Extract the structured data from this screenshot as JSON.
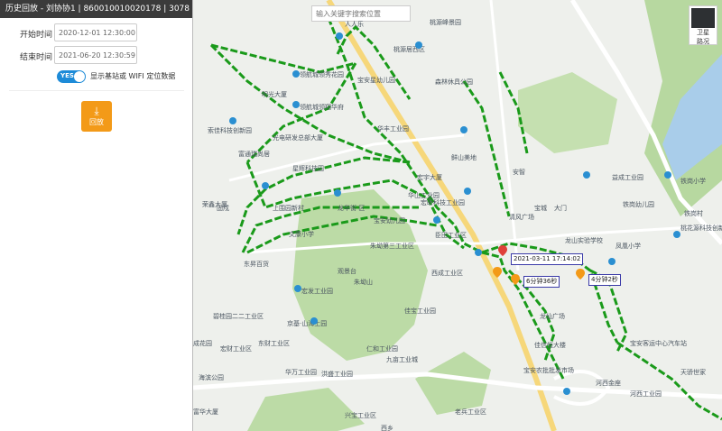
{
  "panel": {
    "title": "历史回放 - 刘协协1 | 860010010020178 | 3078",
    "start_label": "开始时间",
    "start_value": "2020-12-01 12:30:00",
    "end_label": "结束时间",
    "end_value": "2021-06-20 12:30:59",
    "toggle_text": "YES",
    "toggle_on": true,
    "toggle_label": "显示基站或 WIFI 定位数据",
    "replay_label": "回放"
  },
  "map": {
    "search_placeholder": "输入关键字搜索位置",
    "layer_satellite": "卫星",
    "layer_road": "路况",
    "route_color": "#1a9a1a",
    "labels": [
      "人人乐",
      "桃源峰景园",
      "桃源居西区",
      "宝安星幼儿园",
      "森林休具公园",
      "领航城领秀花园",
      "领航城领翔华府",
      "明光大厦",
      "索佳科技创新园",
      "光电研发总部大厦",
      "富通瑞尚居",
      "星辉科技园",
      "华丰工业园",
      "鲜山美地",
      "宏宇大厦",
      "宏昕科技工业园",
      "上围园新村",
      "文康小学",
      "龙华街 区",
      "宝安幼儿园",
      "朱坳第三工业区",
      "观景台",
      "荣鑫大厦",
      "固戍",
      "东昇百货",
      "臣田工业区",
      "龙山实验学校",
      "凤凰小学",
      "铁岗幼儿园",
      "铁岗小学",
      "益成工业园",
      "宏发工业园",
      "京基·山海上园",
      "佳宝工业园",
      "碧桂园二二工业区",
      "成花园",
      "东财工业区",
      "华万工业园",
      "洪盛工业园",
      "宏财工业区",
      "海滨公园",
      "富华大厦",
      "佳信恒大楼",
      "宝安农批批发市场",
      "河西金座",
      "河西工业园",
      "宝安客运中心汽车站",
      "天骄世家",
      "桃花源科技创新园",
      "老兵工业区",
      "九亩工业城",
      "兴宝工业区",
      "西成工业区",
      "龙仙广场",
      "仁和工业园",
      "朱坳山",
      "安智",
      "清风广场",
      "大门",
      "华山工业园",
      "铁岗村",
      "宝城",
      "西乡"
    ],
    "time_tag": "2021-03-11 17:14:02",
    "stay_tags": [
      "6分钟36秒",
      "4分钟2秒"
    ]
  }
}
